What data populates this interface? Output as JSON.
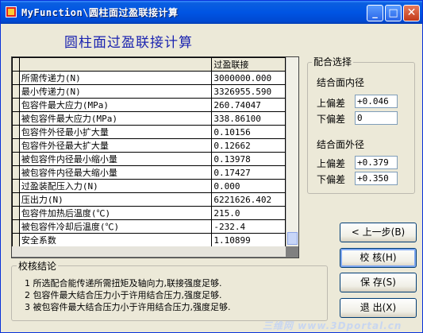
{
  "window": {
    "title": "MyFunction\\圆柱面过盈联接计算",
    "minimize_glyph": "_",
    "maximize_glyph": "□",
    "close_glyph": "✕"
  },
  "heading": "圆柱面过盈联接计算",
  "grid": {
    "column_header": "过盈联接",
    "rows": [
      {
        "label": "所需传递力(N)",
        "value": "3000000.000"
      },
      {
        "label": "最小传递力(N)",
        "value": "3326955.590"
      },
      {
        "label": "包容件最大应力(MPa)",
        "value": "260.74047"
      },
      {
        "label": "被包容件最大应力(MPa)",
        "value": "338.86100"
      },
      {
        "label": "包容件外径最小扩大量",
        "value": "0.10156"
      },
      {
        "label": "包容件外径最大扩大量",
        "value": "0.12662"
      },
      {
        "label": "被包容件内径最小缩小量",
        "value": "0.13978"
      },
      {
        "label": "被包容件内径最大缩小量",
        "value": "0.17427"
      },
      {
        "label": "过盈装配压入力(N)",
        "value": "0.000"
      },
      {
        "label": "压出力(N)",
        "value": "6221626.402"
      },
      {
        "label": "包容件加热后温度(℃)",
        "value": "215.0"
      },
      {
        "label": "被包容件冷却后温度(℃)",
        "value": "-232.4"
      },
      {
        "label": "安全系数",
        "value": "1.10899"
      }
    ]
  },
  "fit": {
    "group_label": "配合选择",
    "inner": {
      "title": "结合面内径",
      "upper_label": "上偏差",
      "upper_value": "+0.046",
      "lower_label": "下偏差",
      "lower_value": "0"
    },
    "outer": {
      "title": "结合面外径",
      "upper_label": "上偏差",
      "upper_value": "+0.379",
      "lower_label": "下偏差",
      "lower_value": "+0.350"
    }
  },
  "conclusion": {
    "group_label": "校核结论",
    "lines": [
      "1 所选配合能传递所需扭矩及轴向力,联接强度足够.",
      "2 包容件最大结合压力小于许用结合压力,强度足够.",
      "3 被包容件最大结合压力小于许用结合压力,强度足够."
    ]
  },
  "buttons": {
    "prev": "< 上一步(B)",
    "check": "校 核(H)",
    "save": "保 存(S)",
    "exit": "退 出(X)"
  },
  "watermark": "三维网 www.3Dportal.cn",
  "colors": {
    "titlebar": "#0054e3",
    "heading": "#1a23b0",
    "window_bg": "#ece9d8"
  }
}
